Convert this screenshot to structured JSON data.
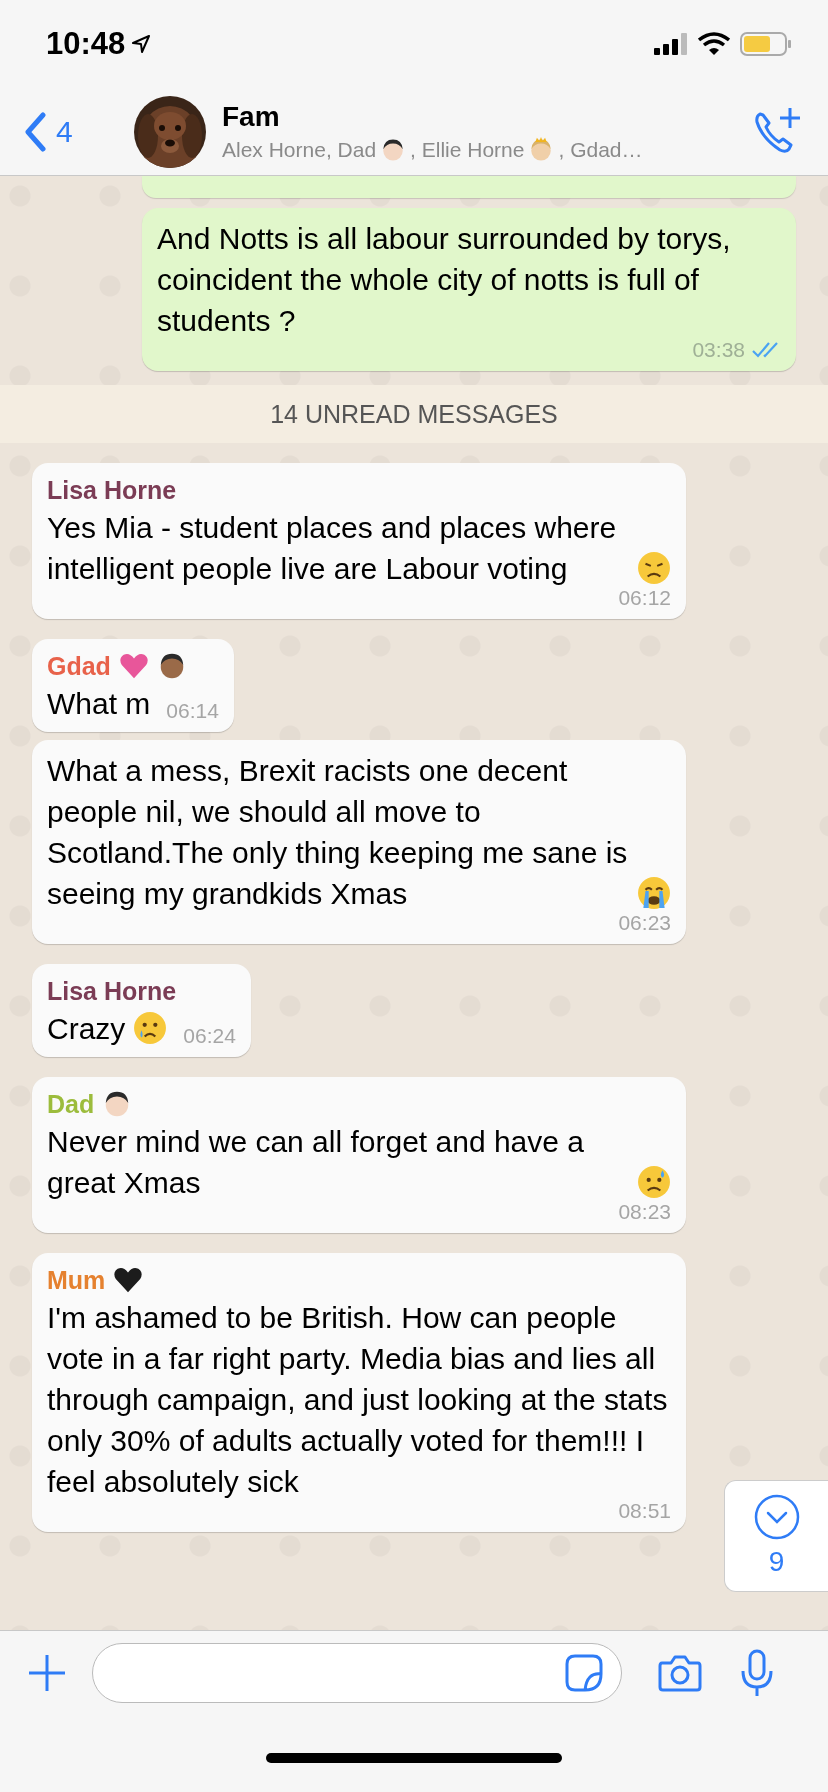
{
  "status_bar": {
    "time": "10:48"
  },
  "header": {
    "back_count": "4",
    "title": "Fam",
    "subtitle": [
      {
        "text": "Alex Horne, Dad",
        "emoji": {
          "kind": "man"
        }
      },
      {
        "text": ", Ellie Horne",
        "emoji": {
          "kind": "princess"
        }
      },
      {
        "text": ", Gdad…"
      }
    ]
  },
  "messages": [
    {
      "kind": "fragment",
      "outgoing": true
    },
    {
      "kind": "message",
      "outgoing": true,
      "text": "And Notts is all labour surrounded by torys, coincident the whole city of notts is full of students ?",
      "time": "03:38",
      "read": true
    },
    {
      "kind": "divider",
      "text": "14 UNREAD MESSAGES"
    },
    {
      "kind": "message",
      "outgoing": false,
      "sender": "Lisa Horne",
      "color": "#7b3c55",
      "text": "Yes Mia - student places and places where intelligent people live are Labour voting",
      "emoji": {
        "kind": "sad"
      },
      "time": "06:12"
    },
    {
      "kind": "message",
      "outgoing": false,
      "sender": "Gdad",
      "sender_emoji": [
        {
          "kind": "heart-pink"
        },
        {
          "kind": "man-dark"
        }
      ],
      "color": "#e8624a",
      "text": "What m",
      "time": "06:14"
    },
    {
      "kind": "message",
      "outgoing": false,
      "text": "What a mess, Brexit racists one decent people nil, we should all move to Scotland.The only thing keeping me sane is seeing my grandkids Xmas",
      "emoji": {
        "kind": "sob"
      },
      "time": "06:23"
    },
    {
      "kind": "message",
      "outgoing": false,
      "sender": "Lisa Horne",
      "color": "#7b3c55",
      "text": "Crazy",
      "emoji": {
        "kind": "cry"
      },
      "time": "06:24"
    },
    {
      "kind": "message",
      "outgoing": false,
      "sender": "Dad",
      "sender_emoji": [
        {
          "kind": "man"
        }
      ],
      "color": "#9cbc3c",
      "text": "Never mind we can all forget and have a great Xmas",
      "emoji": {
        "kind": "sweat"
      },
      "time": "08:23"
    },
    {
      "kind": "message",
      "outgoing": false,
      "sender": "Mum",
      "sender_emoji": [
        {
          "kind": "heart-black"
        }
      ],
      "color": "#e5812f",
      "text": "I'm ashamed to be British. How can people vote in a far right party. Media bias and lies all through campaign,  and just looking at the stats only 30% of adults actually voted for them!!! I feel absolutely sick",
      "time": "08:51"
    }
  ],
  "scroll_button": {
    "count": "9"
  }
}
